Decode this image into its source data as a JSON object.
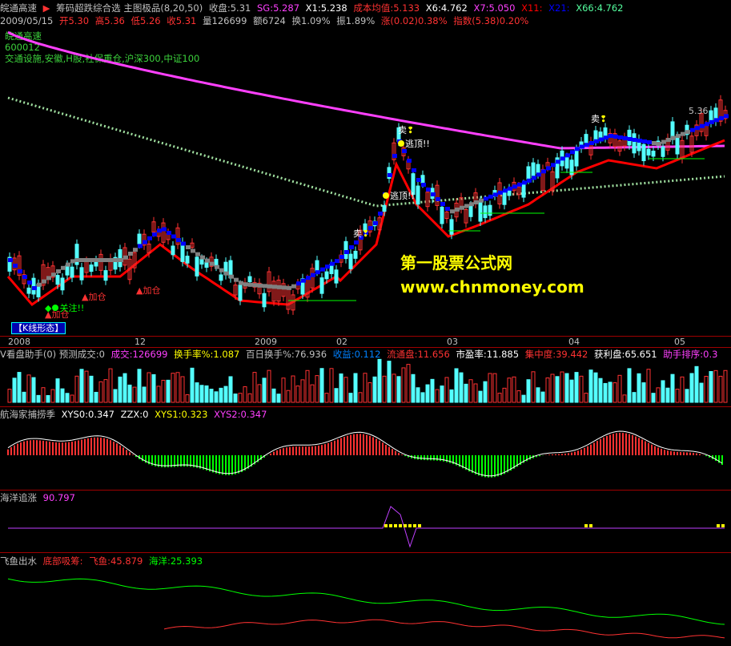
{
  "header": {
    "stock_name": "皖通高速",
    "indicator_name": "筹码超跌综合选 主图极品(8,20,50)",
    "close": "收盘:5.31",
    "sg": "SG:5.287",
    "x1": "X1:5.238",
    "cbjj": "成本均值:5.133",
    "x6": "X6:4.762",
    "x7": "X7:5.050",
    "x11": "X11:",
    "x21": "X21:",
    "x66": "X66:4.762"
  },
  "header2": {
    "date": "2009/05/15",
    "open": "开5.30",
    "high": "高5.36",
    "low": "低5.26",
    "close": "收5.31",
    "vol": "量126699",
    "amount": "额6724",
    "turnover": "换1.09%",
    "amplitude": "振1.89%",
    "change": "涨(0.02)0.38%",
    "index": "指数(5.38)0.20%"
  },
  "stock_box": {
    "name": "皖通高速",
    "code": "600012",
    "sectors": "交通设施,安徽,H股,社保重仓,沪深300,中证100"
  },
  "annotations": {
    "sell1": "卖",
    "sell2": "卖",
    "sell3": "卖",
    "escape1": "逃顶!!",
    "escape2": "逃顶!!",
    "add1": "加仓",
    "add2": "加仓",
    "add3": "加仓",
    "watch": "关注!!",
    "price_high": "5.36",
    "kline_button": "【K线形态】"
  },
  "watermark": {
    "line1": "第一股票公式网",
    "line2": "www.chnmoney.com"
  },
  "axis_labels": [
    "2008",
    "12",
    "2009",
    "02",
    "03",
    "04",
    "05"
  ],
  "volume_pane": {
    "title": "V看盘助手(0) 预测成交:0",
    "chengjiao": "成交:126699",
    "huanshou": "换手率%:1.087",
    "bairi": "百日换手%:76.936",
    "shouyi": "收益:0.112",
    "liutong": "流通盘:11.656",
    "shiying": "市盈率:11.885",
    "jizhong": "集中度:39.442",
    "huoli": "获利盘:65.651",
    "paixu": "助手排序:0.3"
  },
  "pane3": {
    "title": "航海家捕捞季",
    "xys0": "XYS0:0.347",
    "zzx": "ZZX:0",
    "xys1": "XYS1:0.323",
    "xys2": "XYS2:0.347"
  },
  "pane4": {
    "title": "海洋追涨",
    "value": "90.797"
  },
  "pane5": {
    "title": "飞鱼出水",
    "dbxc": "底部吸筹:",
    "feiyu": "飞鱼:45.879",
    "haiyang": "海洋:25.393"
  },
  "colors": {
    "up": "#ff3232",
    "down": "#54ffff",
    "ma_pink": "#ff40ff",
    "ma_red": "#ff0000",
    "ma_blue": "#0000ff",
    "ma_gray": "#808080",
    "yellow": "#ffff00",
    "green": "#00ff00"
  }
}
